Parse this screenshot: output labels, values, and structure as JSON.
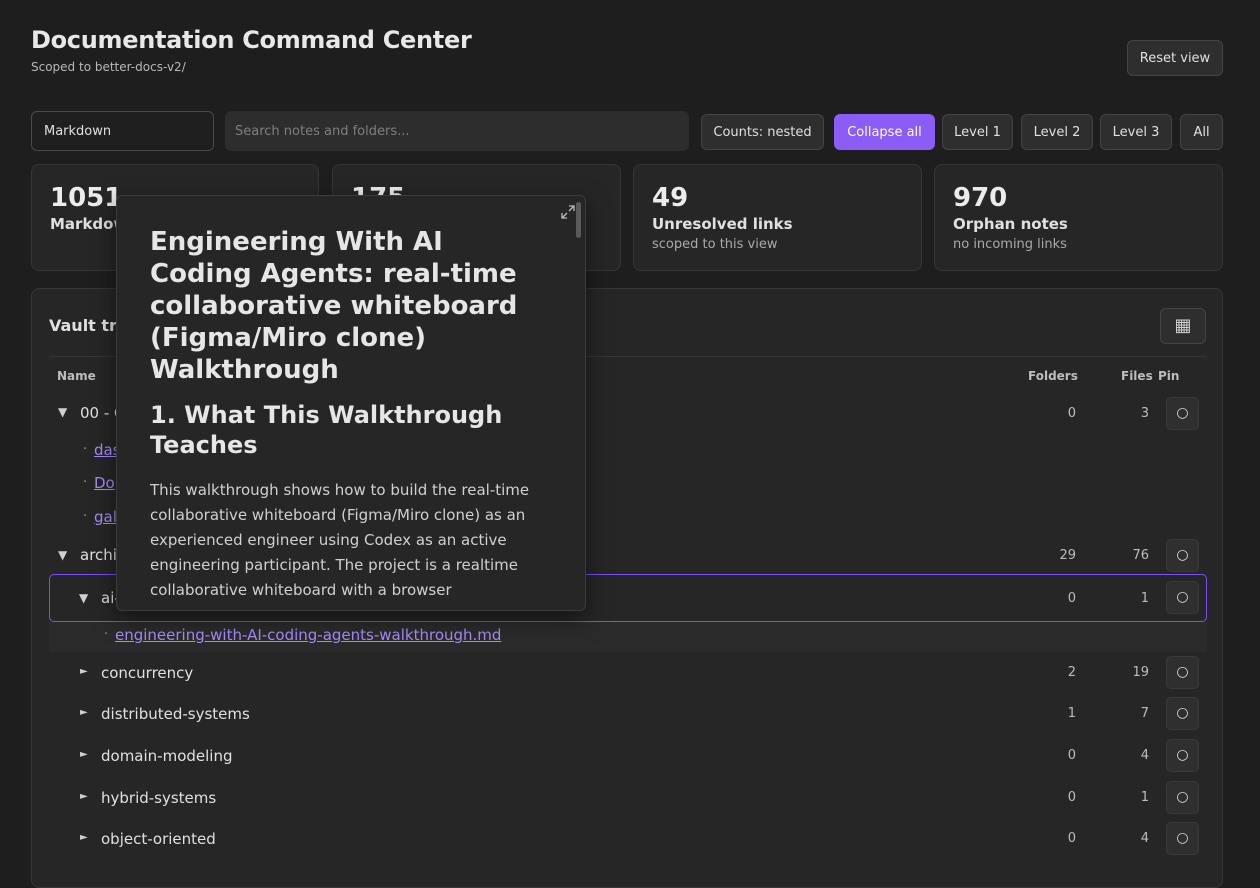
{
  "header": {
    "title": "Documentation Command Center",
    "subtitle": "Scoped to better-docs-v2/",
    "reset_label": "Reset view"
  },
  "toolbar": {
    "source_value": "Markdown",
    "search_placeholder": "Search notes and folders...",
    "counts_label": "Counts: nested",
    "collapse_label": "Collapse all",
    "level1_label": "Level 1",
    "level2_label": "Level 2",
    "level3_label": "Level 3",
    "all_label": "All"
  },
  "stats": [
    {
      "value": "1051",
      "label": "Markdown",
      "sub": ""
    },
    {
      "value": "175",
      "label": "",
      "sub": ""
    },
    {
      "value": "49",
      "label": "Unresolved links",
      "sub": "scoped to this view"
    },
    {
      "value": "970",
      "label": "Orphan notes",
      "sub": "no incoming links"
    }
  ],
  "vault": {
    "title": "Vault tre",
    "grid_icon": "grid-icon",
    "columns": {
      "name": "Name",
      "folders": "Folders",
      "files": "Files",
      "pin": "Pin"
    },
    "rows": [
      {
        "type": "folder",
        "name": "00 - C",
        "folders": "0",
        "files": "3"
      },
      {
        "type": "file",
        "name": "das"
      },
      {
        "type": "file",
        "name": "Do"
      },
      {
        "type": "file",
        "name": "gal"
      },
      {
        "type": "folder",
        "name": "archi",
        "folders": "29",
        "files": "76"
      },
      {
        "type": "folder",
        "name": "ai-",
        "folders": "0",
        "files": "1"
      },
      {
        "type": "file",
        "name": "engineering-with-AI-coding-agents-walkthrough.md"
      },
      {
        "type": "folder",
        "name": "concurrency",
        "folders": "2",
        "files": "19"
      },
      {
        "type": "folder",
        "name": "distributed-systems",
        "folders": "1",
        "files": "7"
      },
      {
        "type": "folder",
        "name": "domain-modeling",
        "folders": "0",
        "files": "4"
      },
      {
        "type": "folder",
        "name": "hybrid-systems",
        "folders": "0",
        "files": "1"
      },
      {
        "type": "folder",
        "name": "object-oriented",
        "folders": "0",
        "files": "4"
      }
    ],
    "pin_glyph": "○",
    "caret_open": "▼",
    "caret_closed": "►",
    "dot": "·"
  },
  "popup": {
    "title": "Engineering With AI Coding Agents: real-time collaborative whiteboard (Figma/Miro clone) Walkthrough",
    "heading": "1. What This Walkthrough Teaches",
    "body": "This walkthrough shows how to build the real-time collaborative whiteboard (Figma/Miro clone) as an experienced engineer using Codex as an active engineering participant. The project is a realtime collaborative whiteboard with a browser"
  }
}
